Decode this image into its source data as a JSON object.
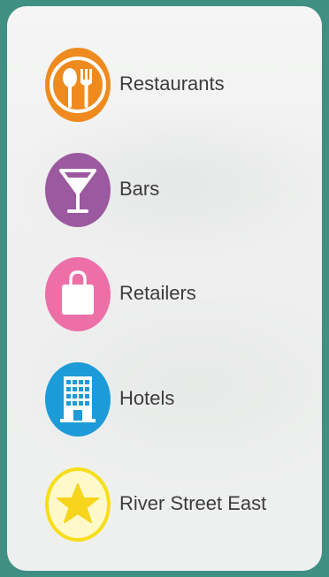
{
  "menu": {
    "items": [
      {
        "label": "Restaurants",
        "icon": "restaurant-icon",
        "color": "#ef8a1f"
      },
      {
        "label": "Bars",
        "icon": "cocktail-icon",
        "color": "#9b59a0"
      },
      {
        "label": "Retailers",
        "icon": "shopping-bag-icon",
        "color": "#ec6fa8"
      },
      {
        "label": "Hotels",
        "icon": "hotel-icon",
        "color": "#1c9bd8"
      },
      {
        "label": "River Street East",
        "icon": "star-icon",
        "color": "#f7dd1a"
      }
    ]
  }
}
